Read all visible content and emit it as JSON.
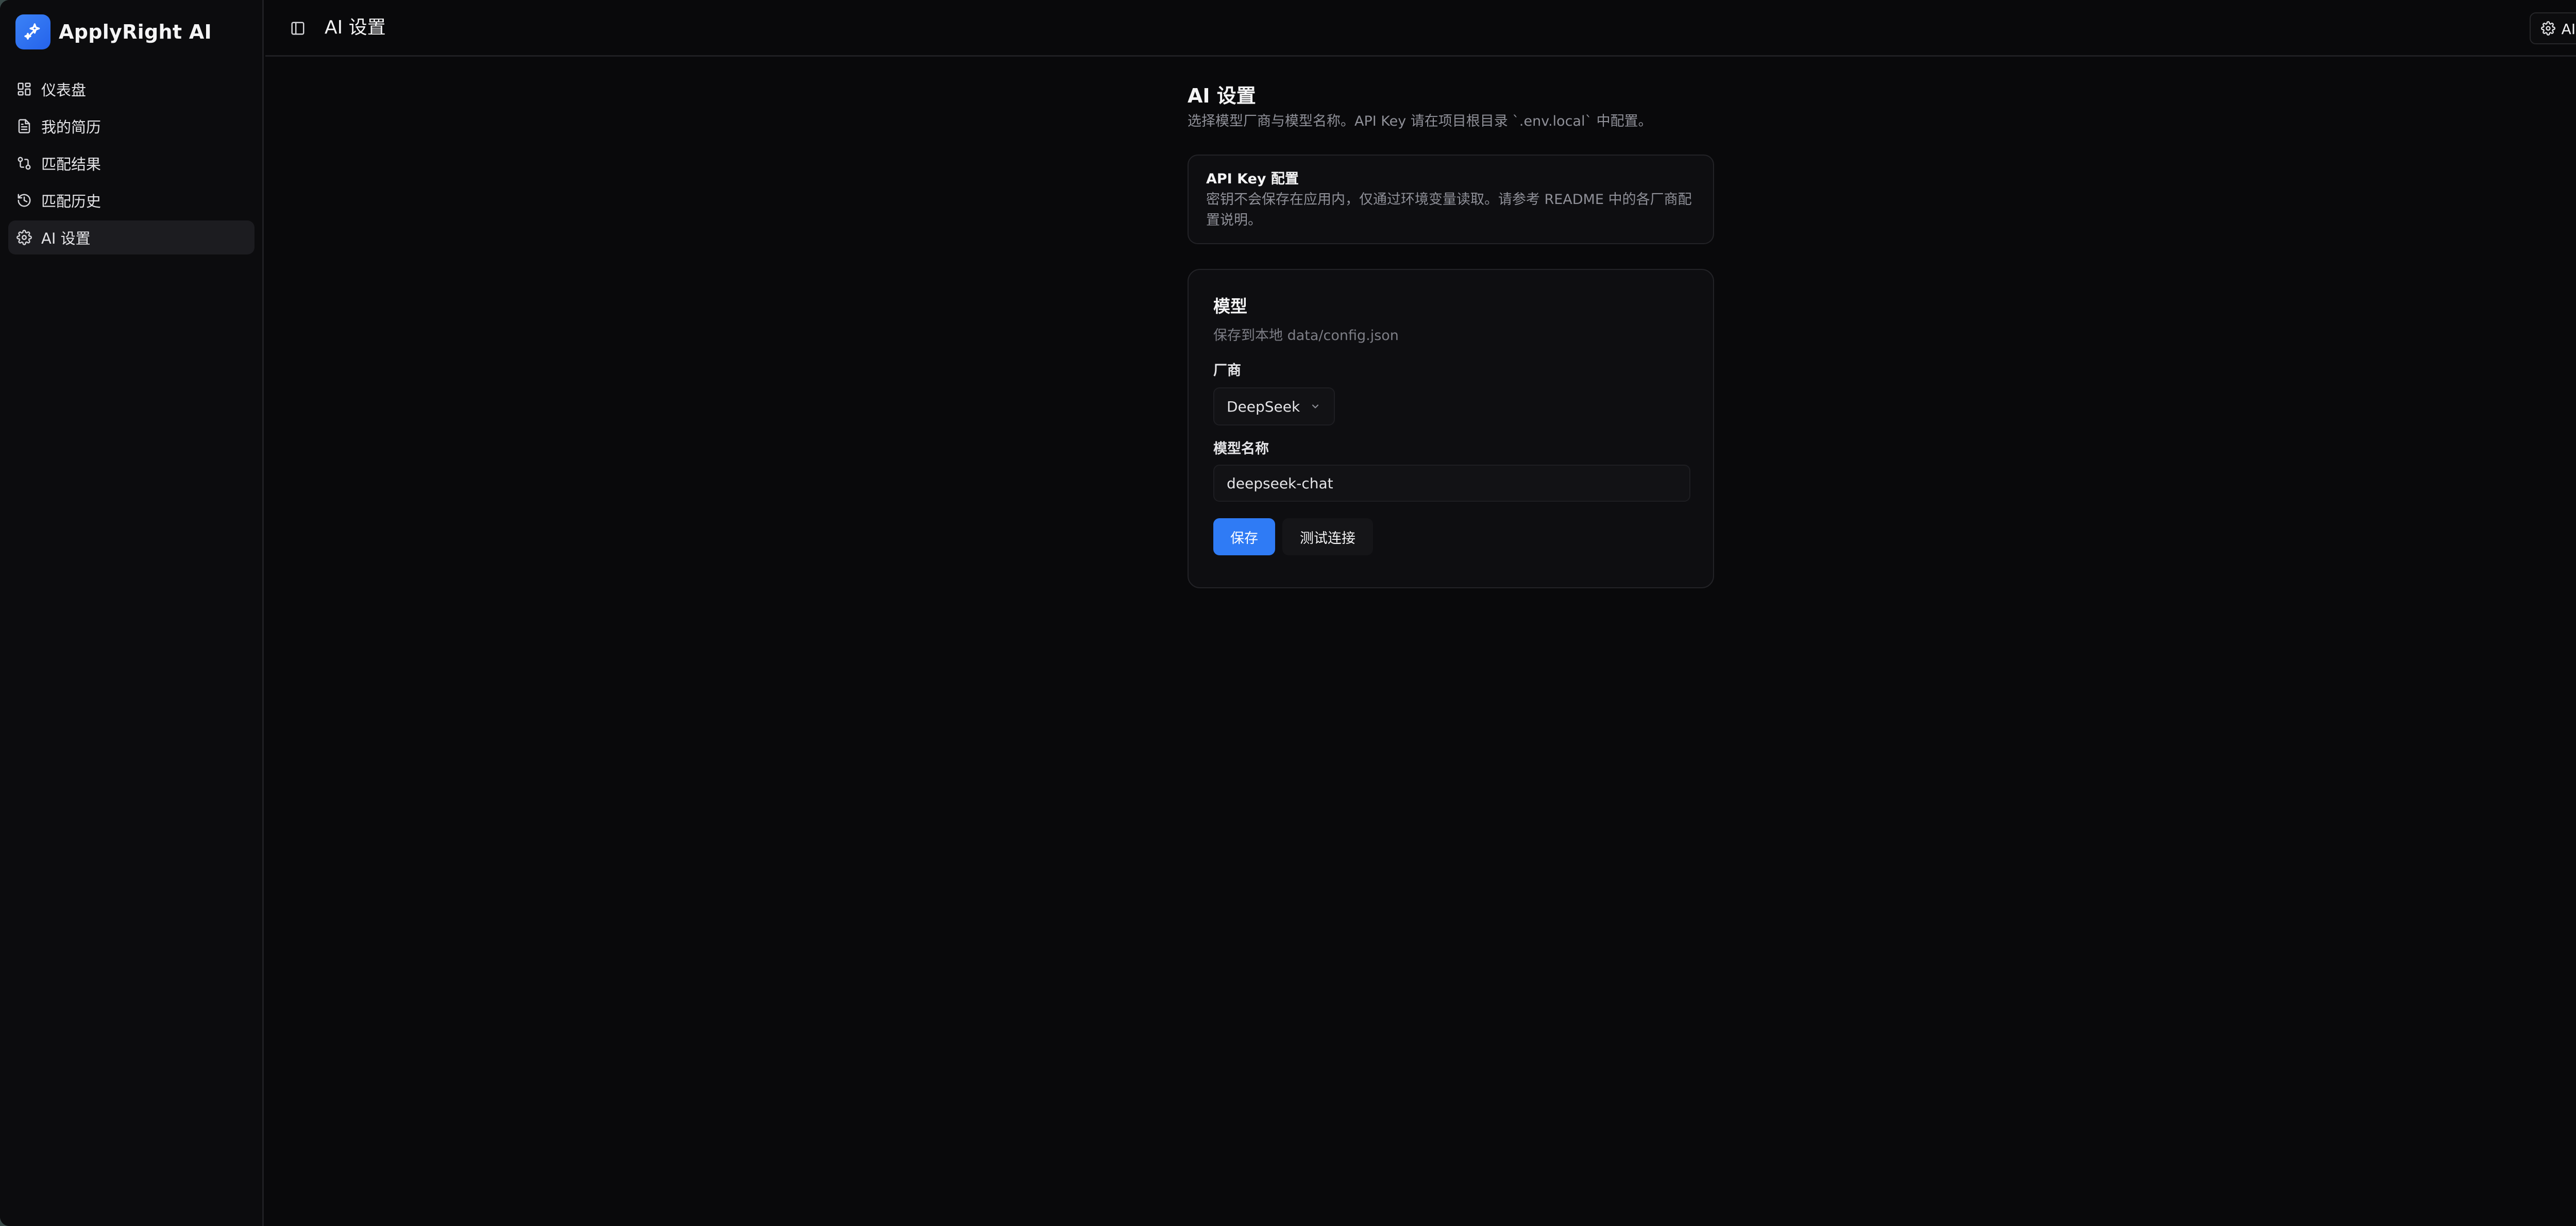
{
  "app": {
    "name": "ApplyRight AI",
    "logo_icon": "sparkle-icon",
    "accent": "#2f7bf5"
  },
  "sidebar": {
    "items": [
      {
        "label": "仪表盘",
        "icon": "dashboard-icon",
        "active": false
      },
      {
        "label": "我的简历",
        "icon": "document-icon",
        "active": false
      },
      {
        "label": "匹配结果",
        "icon": "compare-arrows-icon",
        "active": false
      },
      {
        "label": "匹配历史",
        "icon": "history-icon",
        "active": false
      },
      {
        "label": "AI 设置",
        "icon": "gear-icon",
        "active": true
      }
    ]
  },
  "header": {
    "title": "AI 设置",
    "toggle_icon": "sidebar-toggle-icon",
    "settings_button": {
      "label": "AI 设置",
      "icon": "gear-icon"
    }
  },
  "main": {
    "title": "AI 设置",
    "description": "选择模型厂商与模型名称。API Key 请在项目根目录 `.env.local` 中配置。",
    "api_card": {
      "title": "API Key 配置",
      "description": "密钥不会保存在应用内，仅通过环境变量读取。请参考 README 中的各厂商配置说明。"
    },
    "model_card": {
      "title": "模型",
      "subtitle": "保存到本地 data/config.json",
      "vendor_label": "厂商",
      "vendor_value": "DeepSeek",
      "model_label": "模型名称",
      "model_value": "deepseek-chat",
      "save_label": "保存",
      "test_label": "测试连接"
    }
  }
}
